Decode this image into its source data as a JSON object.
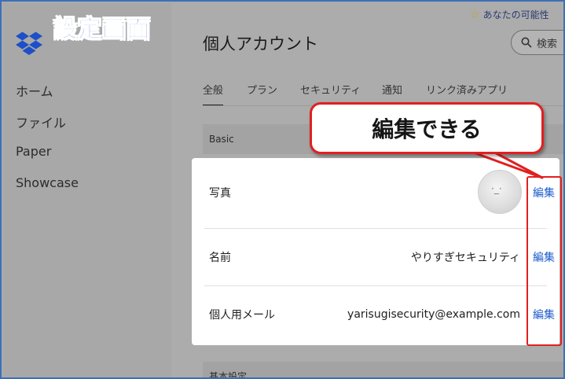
{
  "annotation": {
    "title": "設定画面",
    "callout": "編集できる"
  },
  "sidebar": {
    "items": [
      {
        "label": "ホーム"
      },
      {
        "label": "ファイル"
      },
      {
        "label": "Paper"
      },
      {
        "label": "Showcase"
      }
    ]
  },
  "header": {
    "promo": "あなたの可能性",
    "search_label": "検索",
    "page_title": "個人アカウント"
  },
  "tabs": [
    {
      "label": "全般",
      "active": true
    },
    {
      "label": "プラン"
    },
    {
      "label": "セキュリティ"
    },
    {
      "label": "通知"
    },
    {
      "label": "リンク済みアプリ"
    }
  ],
  "sections": {
    "basic_header": "Basic",
    "next_header": "基本設定"
  },
  "settings": {
    "photo_label": "写真",
    "name_label": "名前",
    "name_value": "やりすぎセキュリティ",
    "email_label": "個人用メール",
    "email_value": "yarisugisecurity@example.com",
    "edit_label": "編集"
  },
  "colors": {
    "accent_blue": "#1f5ccf",
    "annotation_red": "#e02020",
    "title_blue": "#2f6fe0"
  }
}
